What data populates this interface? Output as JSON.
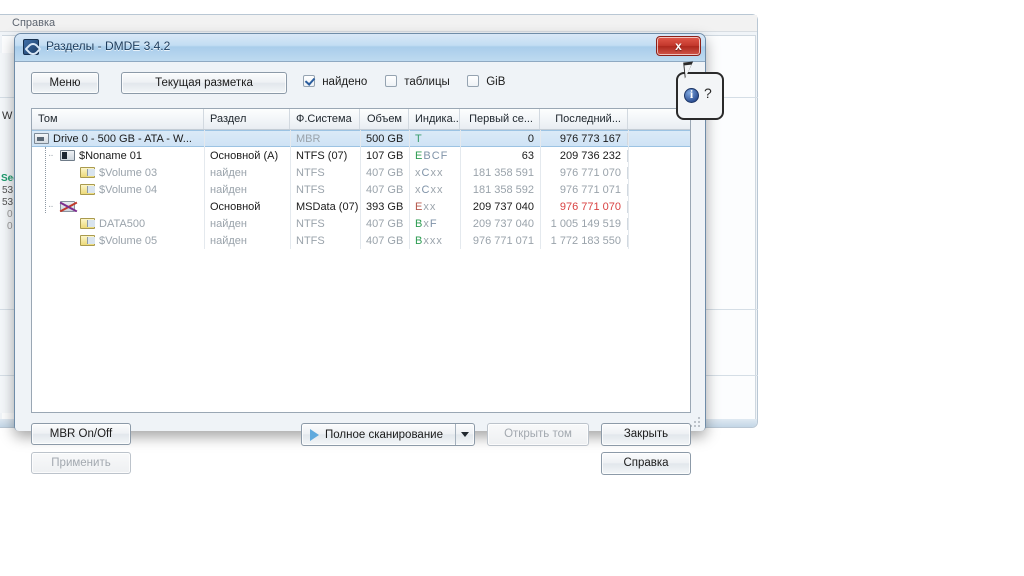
{
  "background_window": {
    "menu_label": "Справка",
    "fragments": {
      "w": "W",
      "sec": "Sec",
      "n1": "53",
      "n2": "53",
      "n3": "0",
      "n4": "0"
    }
  },
  "dialog": {
    "title": "Разделы - DMDE 3.4.2",
    "close_label": "x",
    "toolbar": {
      "menu_button": "Меню",
      "layout_button": "Текущая разметка",
      "checkboxes": [
        {
          "label": "найдено",
          "checked": true
        },
        {
          "label": "таблицы",
          "checked": false
        },
        {
          "label": "GiB",
          "checked": false
        }
      ]
    },
    "table": {
      "columns": [
        "Том",
        "Раздел",
        "Ф.Система",
        "Объем",
        "Индика...",
        "Первый се...",
        "Последний..."
      ],
      "rows": [
        {
          "volume": "Drive 0 - 500 GB - ATA - W...",
          "icon": "drive-icon",
          "indent": 0,
          "partition": "",
          "filesystem": "MBR",
          "size": "500 GB",
          "indicators": [
            {
              "t": "T",
              "c": "t"
            }
          ],
          "first_sector": "0",
          "last_sector": "976 773 167",
          "selected": true,
          "last_red": false
        },
        {
          "volume": "$Noname 01",
          "icon": "partition-icon",
          "indent": 1,
          "partition": "Основной (A)",
          "filesystem": "NTFS (07)",
          "size": "107 GB",
          "indicators": [
            {
              "t": "E",
              "c": "g"
            },
            {
              "t": "B",
              "c": "b"
            },
            {
              "t": "C",
              "c": "b"
            },
            {
              "t": "F",
              "c": "b"
            }
          ],
          "first_sector": "63",
          "last_sector": "209 736 232",
          "selected": false,
          "last_red": false
        },
        {
          "volume": "$Volume 03",
          "icon": "volume-icon",
          "indent": 2,
          "partition": "найден",
          "filesystem": "NTFS",
          "size": "407 GB",
          "indicators": [
            {
              "t": "x",
              "c": "x"
            },
            {
              "t": "C",
              "c": "b"
            },
            {
              "t": "x",
              "c": "x"
            },
            {
              "t": "x",
              "c": "x"
            }
          ],
          "first_sector": "181 358 591",
          "last_sector": "976 771 070",
          "selected": false,
          "last_red": false
        },
        {
          "volume": "$Volume 04",
          "icon": "volume-icon",
          "indent": 2,
          "partition": "найден",
          "filesystem": "NTFS",
          "size": "407 GB",
          "indicators": [
            {
              "t": "x",
              "c": "x"
            },
            {
              "t": "C",
              "c": "b"
            },
            {
              "t": "x",
              "c": "x"
            },
            {
              "t": "x",
              "c": "x"
            }
          ],
          "first_sector": "181 358 592",
          "last_sector": "976 771 071",
          "selected": false,
          "last_red": false
        },
        {
          "volume": "",
          "icon": "crossed-partition-icon",
          "indent": 1,
          "partition": "Основной",
          "filesystem": "MSData (07)",
          "size": "393 GB",
          "indicators": [
            {
              "t": "E",
              "c": "r"
            },
            {
              "t": "x",
              "c": "x"
            },
            {
              "t": "x",
              "c": "x"
            }
          ],
          "first_sector": "209 737 040",
          "last_sector": "976 771 070",
          "selected": false,
          "last_red": true
        },
        {
          "volume": "DATA500",
          "icon": "volume-icon",
          "indent": 2,
          "partition": "найден",
          "filesystem": "NTFS",
          "size": "407 GB",
          "indicators": [
            {
              "t": "B",
              "c": "g"
            },
            {
              "t": "x",
              "c": "x"
            },
            {
              "t": "F",
              "c": "b"
            }
          ],
          "first_sector": "209 737 040",
          "last_sector": "1 005 149 519",
          "selected": false,
          "last_red": false
        },
        {
          "volume": "$Volume 05",
          "icon": "volume-icon",
          "indent": 2,
          "partition": "найден",
          "filesystem": "NTFS",
          "size": "407 GB",
          "indicators": [
            {
              "t": "B",
              "c": "g"
            },
            {
              "t": "x",
              "c": "x"
            },
            {
              "t": "x",
              "c": "x"
            },
            {
              "t": "x",
              "c": "x"
            }
          ],
          "first_sector": "976 771 071",
          "last_sector": "1 772 183 550",
          "selected": false,
          "last_red": false
        }
      ]
    },
    "footer": {
      "mbr_button": "MBR On/Off",
      "apply_button": "Применить",
      "scan_button": "Полное сканирование",
      "open_volume_button": "Открыть том",
      "close_button": "Закрыть",
      "help_button": "Справка"
    }
  },
  "callout": {
    "info_icon": "info-icon",
    "question_mark": "?"
  }
}
